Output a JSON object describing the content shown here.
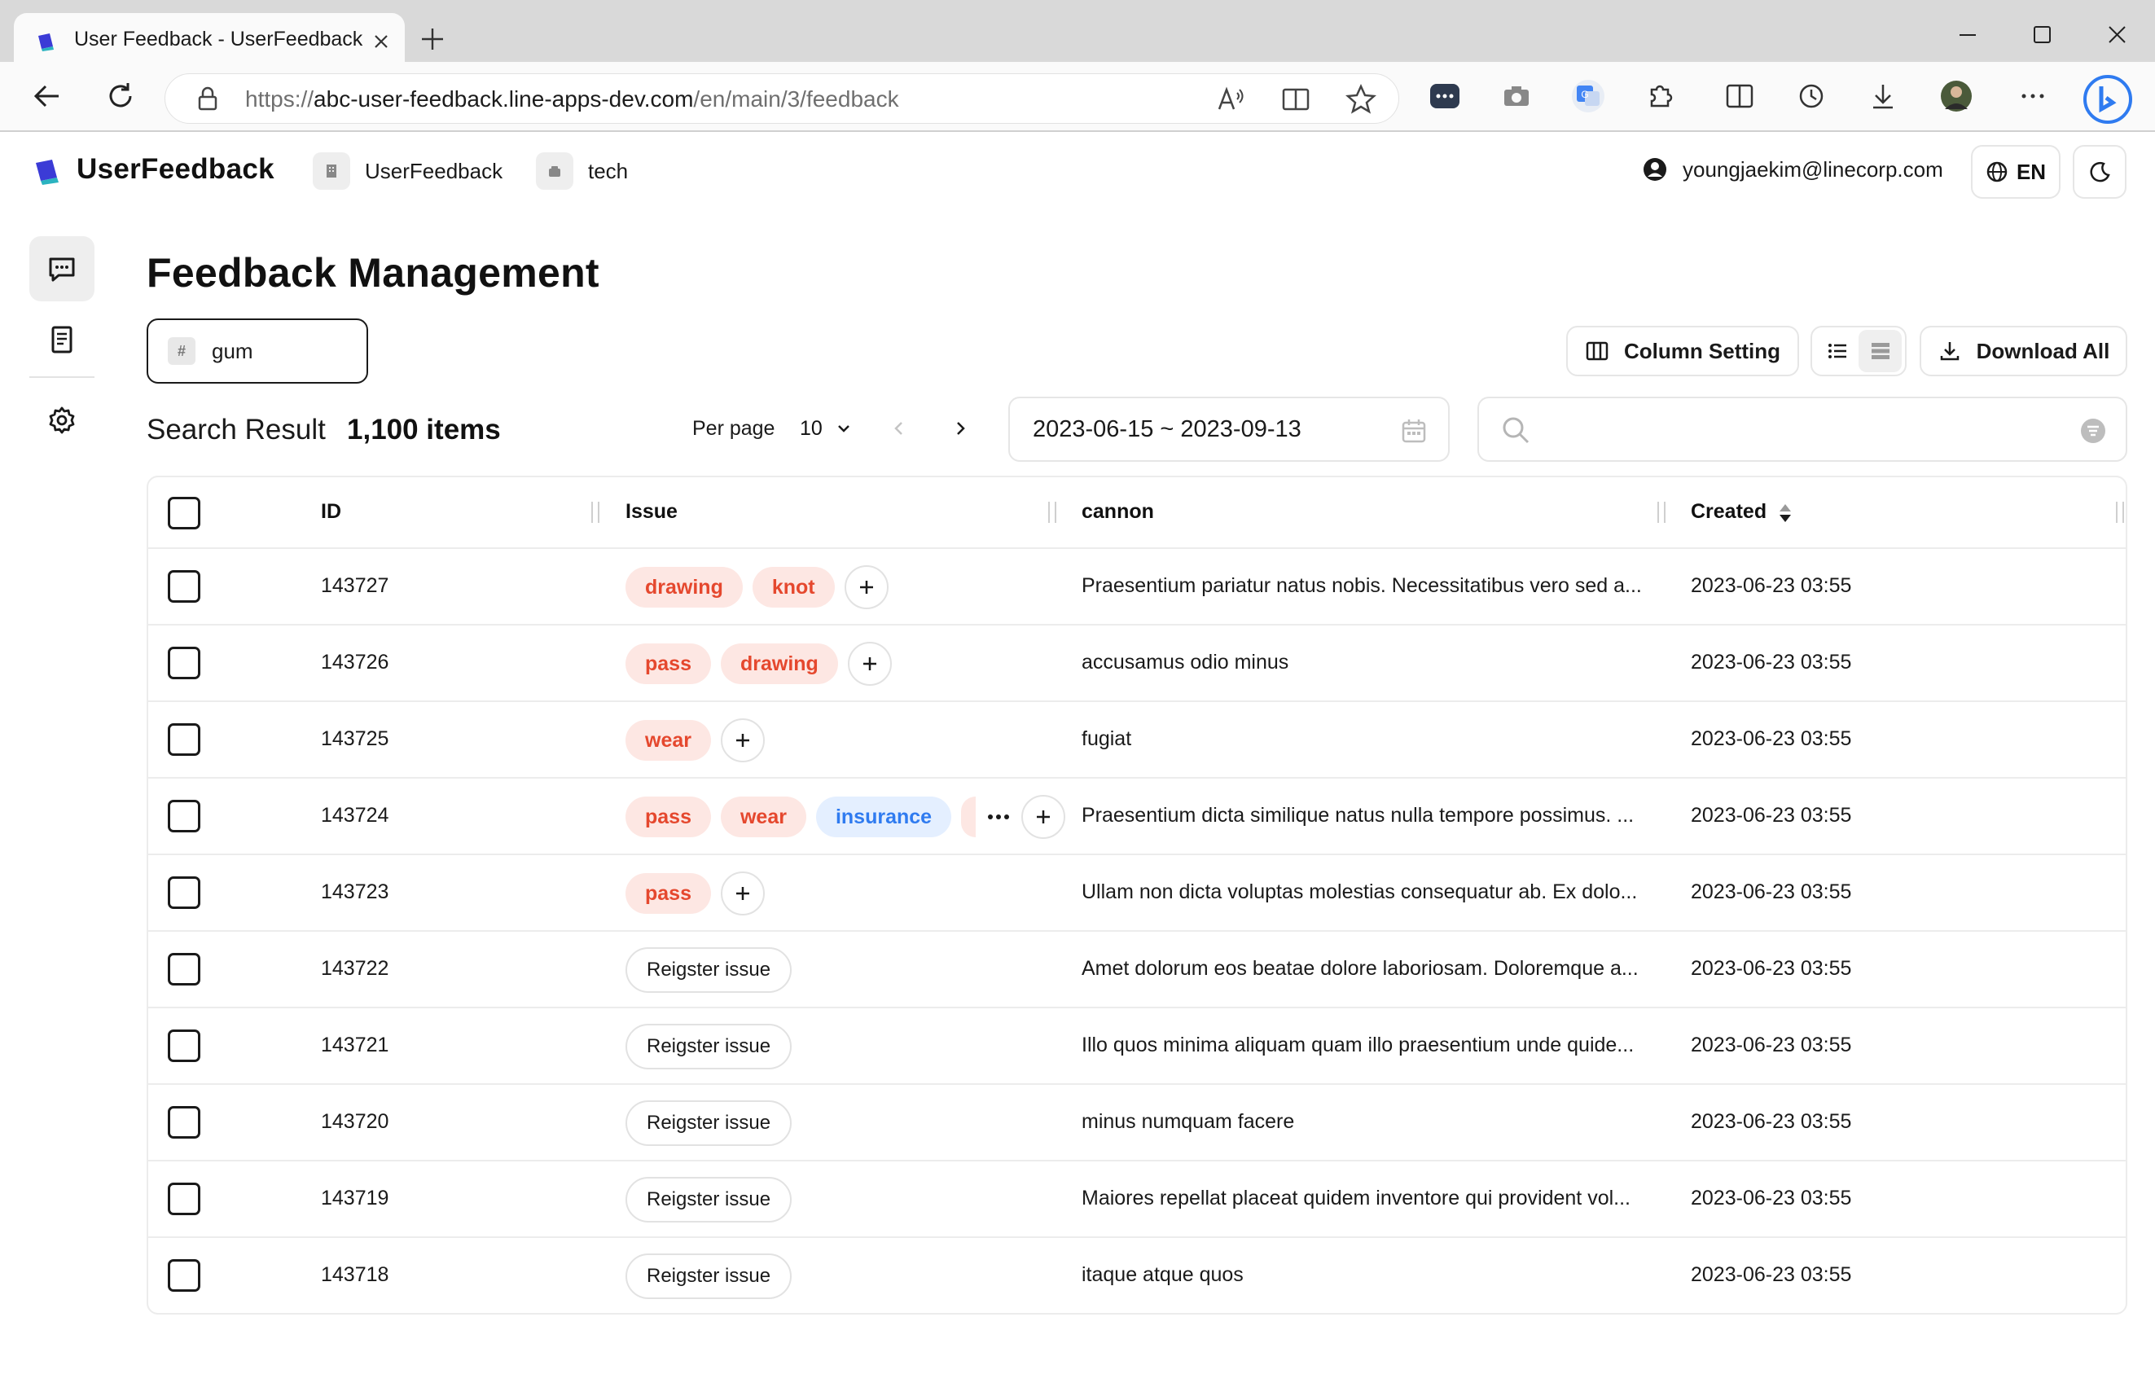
{
  "browser": {
    "tab_title": "User Feedback - UserFeedback",
    "url_prefix": "https://",
    "url_host": "abc-user-feedback.line-apps-dev.com",
    "url_path": "/en/main/3/feedback"
  },
  "header": {
    "logo": "UserFeedback",
    "project": "UserFeedback",
    "channel": "tech",
    "user_email": "youngjaekim@linecorp.com",
    "language": "EN"
  },
  "page": {
    "title": "Feedback Management",
    "channel_select": "gum",
    "column_setting": "Column Setting",
    "download_all": "Download All",
    "search_result_label": "Search Result",
    "search_result_count": "1,100 items",
    "per_page_label": "Per page",
    "per_page_value": "10",
    "date_range": "2023-06-15 ~ 2023-09-13",
    "search_placeholder": ""
  },
  "table": {
    "columns": [
      "ID",
      "Issue",
      "cannon",
      "Created"
    ],
    "register_label": "Reigster issue",
    "rows": [
      {
        "id": "143727",
        "issues": [
          "drawing",
          "knot"
        ],
        "cannon": "Praesentium pariatur natus nobis. Necessitatibus vero sed a...",
        "created": "2023-06-23 03:55"
      },
      {
        "id": "143726",
        "issues": [
          "pass",
          "drawing"
        ],
        "cannon": "accusamus odio minus",
        "created": "2023-06-23 03:55"
      },
      {
        "id": "143725",
        "issues": [
          "wear"
        ],
        "cannon": "fugiat",
        "created": "2023-06-23 03:55"
      },
      {
        "id": "143724",
        "issues": [
          "pass",
          "wear",
          "insurance"
        ],
        "cannon": "Praesentium dicta similique natus nulla tempore possimus. ...",
        "created": "2023-06-23 03:55"
      },
      {
        "id": "143723",
        "issues": [
          "pass"
        ],
        "cannon": "Ullam non dicta voluptas molestias consequatur ab. Ex dolo...",
        "created": "2023-06-23 03:55"
      },
      {
        "id": "143722",
        "issues": [],
        "cannon": "Amet dolorum eos beatae dolore laboriosam. Doloremque a...",
        "created": "2023-06-23 03:55"
      },
      {
        "id": "143721",
        "issues": [],
        "cannon": "Illo quos minima aliquam quam illo praesentium unde quide...",
        "created": "2023-06-23 03:55"
      },
      {
        "id": "143720",
        "issues": [],
        "cannon": "minus numquam facere",
        "created": "2023-06-23 03:55"
      },
      {
        "id": "143719",
        "issues": [],
        "cannon": "Maiores repellat placeat quidem inventore qui provident vol...",
        "created": "2023-06-23 03:55"
      },
      {
        "id": "143718",
        "issues": [],
        "cannon": "itaque atque quos",
        "created": "2023-06-23 03:55"
      }
    ]
  },
  "colors": {
    "tag_red_bg": "#fde7e3",
    "tag_red_text": "#e5482e",
    "tag_blue_bg": "#e4efff",
    "tag_blue_text": "#2f7bf0",
    "border": "#ececec"
  }
}
